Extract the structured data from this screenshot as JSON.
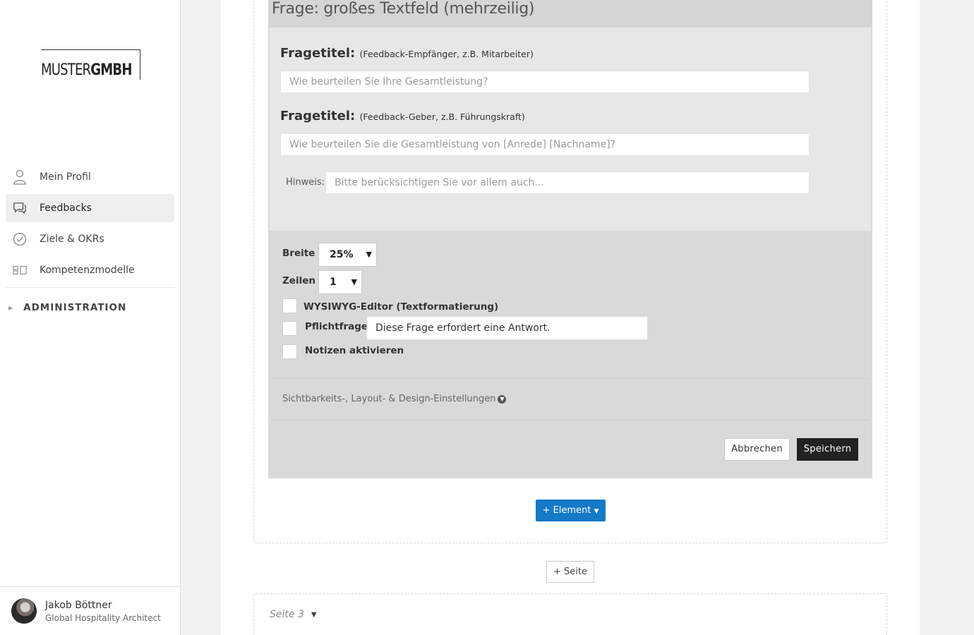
{
  "logo": {
    "light": "MUSTER",
    "bold": "GMBH"
  },
  "nav": {
    "items": [
      {
        "label": "Mein Profil",
        "icon": "user-icon"
      },
      {
        "label": "Feedbacks",
        "icon": "chat-icon"
      },
      {
        "label": "Ziele & OKRs",
        "icon": "check-circle-icon"
      },
      {
        "label": "Kompetenzmodelle",
        "icon": "grid-icon"
      }
    ],
    "admin": "ADMINISTRATION"
  },
  "user": {
    "name": "Jakob Böttner",
    "role": "Global Hospitality Architect"
  },
  "question": {
    "title": "Frage: großes Textfeld (mehrzeilig)",
    "field1": {
      "label": "Fragetitel:",
      "sub": "(Feedback-Empfänger, z.B. Mitarbeiter)",
      "placeholder": "Wie beurteilen Sie Ihre Gesamtleistung?"
    },
    "field2": {
      "label": "Fragetitel:",
      "sub": "(Feedback-Geber, z.B. Führungskraft)",
      "placeholder": "Wie beurteilen Sie die Gesamtleistung von [Anrede] [Nachname]?"
    },
    "hint": {
      "label": "Hinweis:",
      "placeholder": "Bitte berücksichtigen Sie vor allem auch..."
    },
    "settings": {
      "width_label": "Breite",
      "width_value": "25%",
      "rows_label": "Zeilen",
      "rows_value": "1",
      "wysiwyg_label": "WYSIWYG-Editor (Textformatierung)",
      "required_label": "Pflichtfrage",
      "required_text": "Diese Frage erfordert eine Antwort.",
      "notes_label": "Notizen aktivieren"
    },
    "visibility": "Sichtbarkeits-, Layout- & Design-Einstellungen",
    "cancel": "Abbrechen",
    "save": "Speichern"
  },
  "add_element": "+ Element",
  "add_page": "+ Seite",
  "page3": "Seite 3",
  "colors": {
    "accent": "#1479c7",
    "save": "#222222"
  }
}
